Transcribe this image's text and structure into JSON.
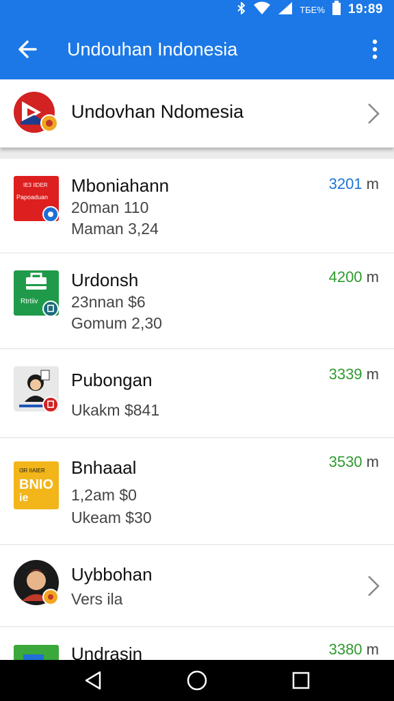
{
  "status_bar": {
    "battery_text": "ТБЕ%",
    "time": "19:89"
  },
  "app_bar": {
    "title": "Undouhan Indonesia"
  },
  "header": {
    "title": "Undovhan Ndomesia"
  },
  "items": [
    {
      "name": "Mboniahann",
      "line1": "20man 110",
      "line2": "Maman 3,24",
      "amount": "3201",
      "unit": "m",
      "amount_color": "#1a74d6"
    },
    {
      "name": "Urdonsh",
      "line1": "23nnan $6",
      "line2": "Gomum 2,30",
      "amount": "4200",
      "unit": "m",
      "amount_color": "#2e9a2e"
    },
    {
      "name": "Pubongan",
      "line1": "Ukakm $841",
      "amount": "3339",
      "unit": "m",
      "amount_color": "#2e9a2e"
    },
    {
      "name": "Bnhaaal",
      "line1": "1,2am $0",
      "line2": "Ukeam $30",
      "amount": "3530",
      "unit": "m",
      "amount_color": "#2e9a2e"
    },
    {
      "name": "Uybbohan",
      "line1": "Vers ila"
    },
    {
      "name": "Undrasin",
      "amount": "3380",
      "unit": "m",
      "amount_color": "#2e9a2e"
    }
  ],
  "icons": {
    "item1_icon_text_a": "IE3 IIDER",
    "item1_icon_text_b": "Papoaduan",
    "item2_icon_text": "Rtrtiiv",
    "item4_icon_text_a": "I3R IIAIER",
    "item4_icon_text_b": "BNIO",
    "item4_icon_text_c": "ie"
  },
  "colors": {
    "primary": "#1c78e6",
    "amount_blue": "#1a74d6",
    "amount_green": "#2e9a2e"
  }
}
